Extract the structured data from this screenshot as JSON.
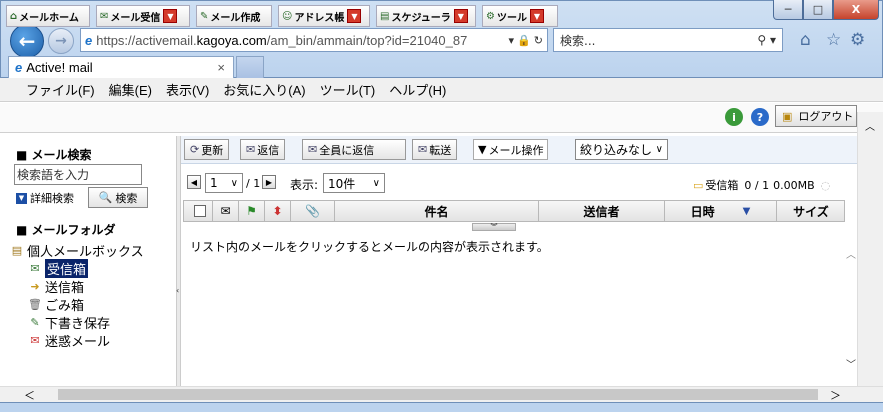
{
  "browser": {
    "url_prefix": "https://activemail.",
    "url_domain": "kagoya.com",
    "url_suffix": "/am_bin/ammain/top?id=21040_87",
    "search_placeholder": "検索...",
    "tab_title": "Active! mail",
    "tab_close": "×",
    "window_buttons": [
      "─",
      "□",
      "X"
    ]
  },
  "menu": [
    "ファイル(F)",
    "編集(E)",
    "表示(V)",
    "お気に入り(A)",
    "ツール(T)",
    "ヘルプ(H)"
  ],
  "app_tabs": [
    {
      "label": "メールホーム",
      "icon": "home-icon"
    },
    {
      "label": "メール受信",
      "icon": "inbox-icon"
    },
    {
      "label": "メール作成",
      "icon": "compose-icon"
    },
    {
      "label": "アドレス帳",
      "icon": "addressbook-icon"
    },
    {
      "label": "スケジューラ",
      "icon": "calendar-icon"
    },
    {
      "label": "ツール",
      "icon": "gear-icon"
    }
  ],
  "logout_label": "ログアウト",
  "sidebar": {
    "search_header": "メール検索",
    "search_placeholder": "検索語を入力",
    "advanced_label": "詳細検索",
    "search_button": "検索",
    "folder_header": "メールフォルダ",
    "mailbox": "個人メールボックス",
    "folders": [
      "受信箱",
      "送信箱",
      "ごみ箱",
      "下書き保存",
      "迷惑メール"
    ]
  },
  "toolbar": {
    "refresh": "更新",
    "reply": "返信",
    "reply_all": "全員に返信",
    "forward": "転送",
    "mail_ops": "メール操作",
    "filter": "絞り込みなし"
  },
  "pager": {
    "page": "1",
    "total": "/ 1",
    "display_label": "表示:",
    "per_page": "10件",
    "folder": "受信箱",
    "count": "0 / 1",
    "size": "0.00MB"
  },
  "columns": {
    "subject": "件名",
    "sender": "送信者",
    "date": "日時",
    "size": "サイズ"
  },
  "list_message": "リスト内のメールをクリックするとメールの内容が表示されます。"
}
